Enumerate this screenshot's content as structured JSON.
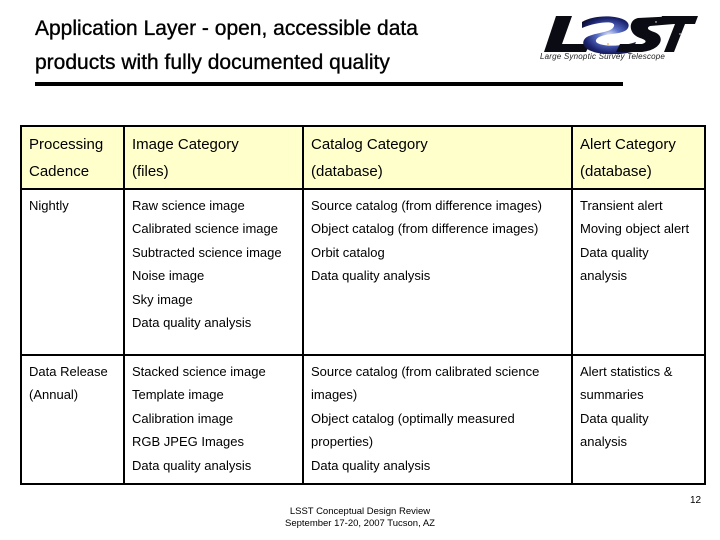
{
  "slide": {
    "title_lines": [
      "Application Layer -  open, accessible data",
      "products with fully documented quality"
    ],
    "logo": {
      "icon": "lsst-logo-icon",
      "letters": "LSST",
      "caption": "Large Synoptic Survey Telescope"
    },
    "colors": {
      "header_fill": "#ffffcc",
      "border": "#000000",
      "text": "#000000"
    },
    "footer": {
      "line1": "LSST Conceptual Design Review",
      "line2": "September 17-20, 2007 Tucson, AZ"
    },
    "page_number": "12"
  },
  "table": {
    "headers": [
      [
        "Processing",
        "Cadence"
      ],
      [
        "Image Category",
        "(files)"
      ],
      [
        "Catalog Category",
        "(database)"
      ],
      [
        "Alert Category",
        "(database)"
      ]
    ],
    "rows": [
      {
        "cadence": [
          "Nightly"
        ],
        "image": [
          "Raw science image",
          "Calibrated science image",
          "Subtracted science image",
          "Noise image",
          "Sky image",
          "Data quality analysis"
        ],
        "catalog": [
          "Source catalog (from difference images)",
          "Object catalog (from difference images)",
          "Orbit catalog",
          "Data quality analysis"
        ],
        "alert": [
          "Transient alert",
          "Moving object alert",
          "Data quality",
          "analysis"
        ]
      },
      {
        "cadence": [
          "Data Release",
          "(Annual)"
        ],
        "image": [
          "Stacked science image",
          "Template image",
          "Calibration image",
          "RGB JPEG Images",
          "Data quality analysis"
        ],
        "catalog": [
          "Source catalog (from calibrated science",
          "images)",
          "Object catalog (optimally measured",
          "properties)",
          "Data quality analysis"
        ],
        "alert": [
          "Alert statistics &",
          "summaries",
          "Data quality",
          "analysis"
        ]
      }
    ]
  }
}
